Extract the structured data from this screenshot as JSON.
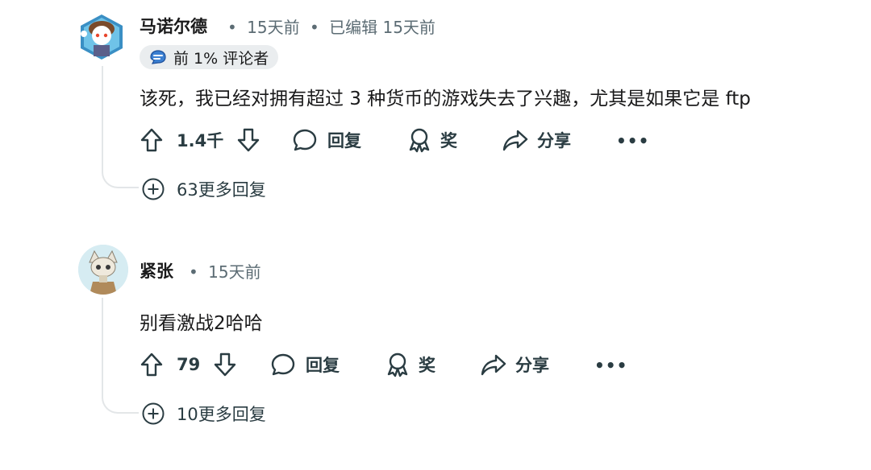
{
  "comments": [
    {
      "author": "马诺尔德",
      "sep": "•",
      "time": "15天前",
      "edited": "已编辑 15天前",
      "flair": "前 1% 评论者",
      "text": "该死，我已经对拥有超过 3 种货币的游戏失去了兴趣，尤其是如果它是 ftp",
      "upvotes": "1.4千",
      "reply_label": "回复",
      "award_label": "奖",
      "share_label": "分享",
      "more_label": "•••",
      "more_replies": "63更多回复"
    },
    {
      "author": "紧张",
      "sep": "•",
      "time": "15天前",
      "text": "别看激战2哈哈",
      "upvotes": "79",
      "reply_label": "回复",
      "award_label": "奖",
      "share_label": "分享",
      "more_label": "•••",
      "more_replies": "10更多回复"
    }
  ],
  "colors": {
    "text": "#1a1a1b",
    "meta": "#5c6c74",
    "thread": "#e3e6e8",
    "flair_bg": "#eaedef"
  }
}
